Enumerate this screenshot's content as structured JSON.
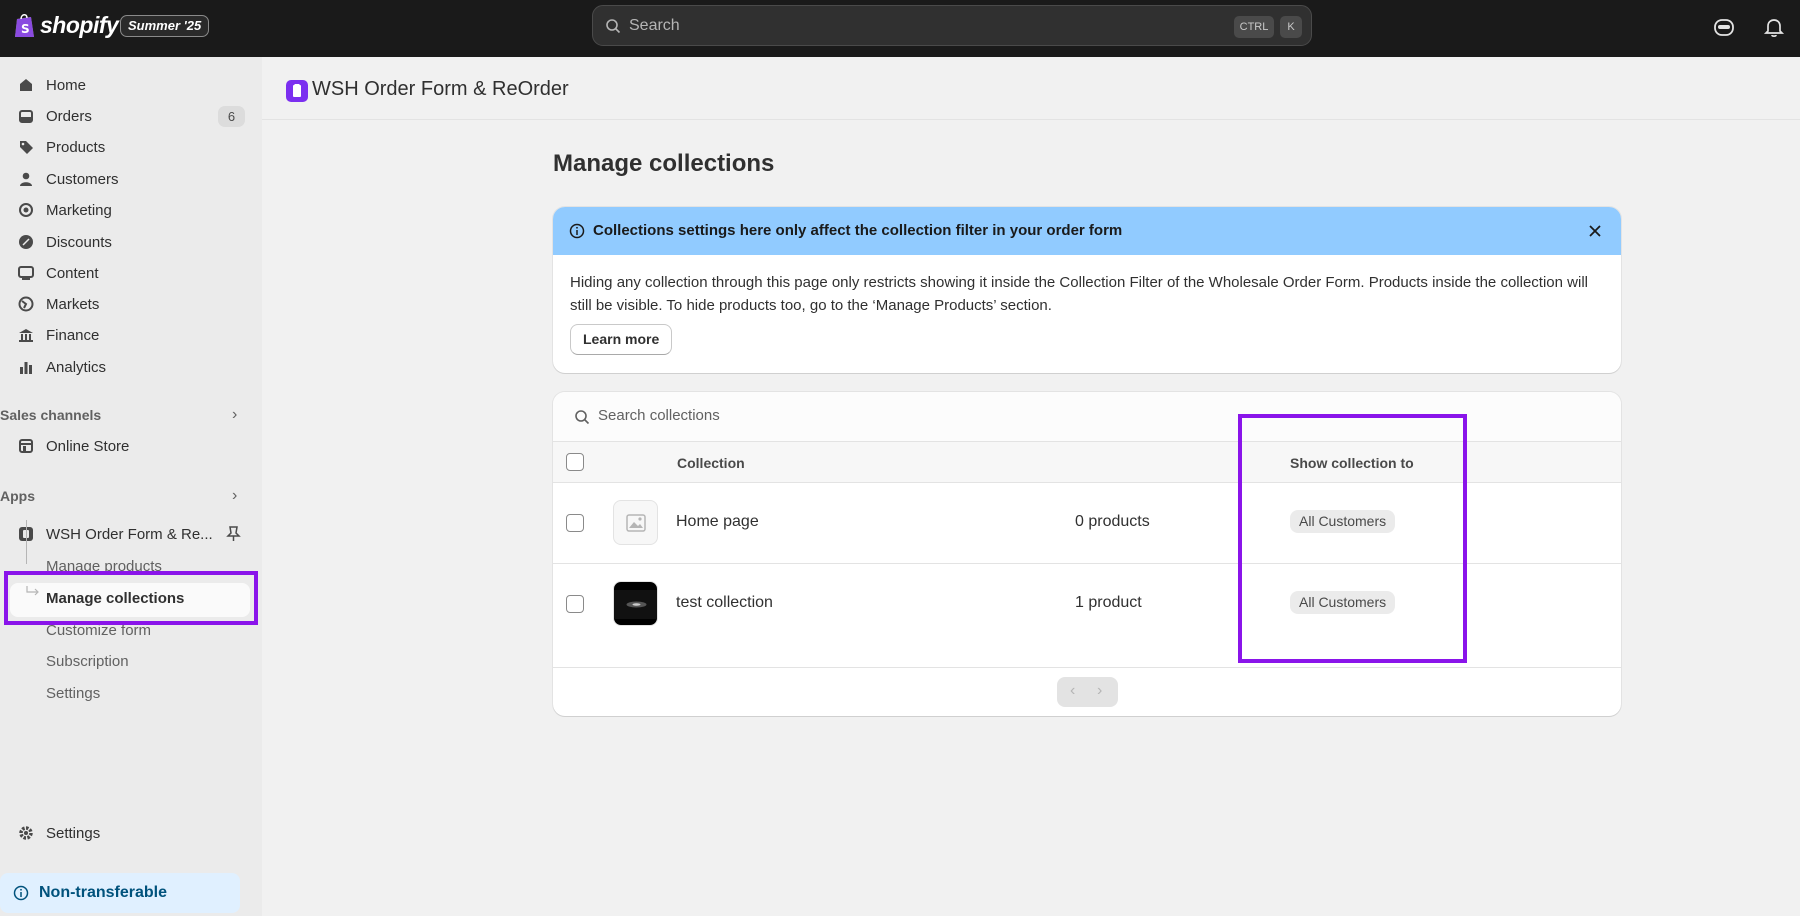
{
  "topbar": {
    "brand": "shopify",
    "edition_badge": "Summer '25",
    "search_placeholder": "Search",
    "shortcut_ctrl": "CTRL",
    "shortcut_key": "K"
  },
  "sidebar": {
    "items": [
      {
        "label": "Home",
        "icon": "home-icon"
      },
      {
        "label": "Orders",
        "icon": "orders-icon",
        "badge": "6"
      },
      {
        "label": "Products",
        "icon": "tag-icon"
      },
      {
        "label": "Customers",
        "icon": "person-icon"
      },
      {
        "label": "Marketing",
        "icon": "target-icon"
      },
      {
        "label": "Discounts",
        "icon": "discount-icon"
      },
      {
        "label": "Content",
        "icon": "image-icon"
      },
      {
        "label": "Markets",
        "icon": "globe-icon"
      },
      {
        "label": "Finance",
        "icon": "bank-icon"
      },
      {
        "label": "Analytics",
        "icon": "chart-icon"
      }
    ],
    "sales_channels_heading": "Sales channels",
    "online_store": "Online Store",
    "apps_heading": "Apps",
    "app_name": "WSH Order Form & Re...",
    "app_subitems": [
      "Manage products",
      "Manage collections",
      "Customize form",
      "Subscription",
      "Settings"
    ],
    "settings": "Settings",
    "non_transferable": "Non-transferable"
  },
  "app_header": {
    "title": "WSH Order Form & ReOrder"
  },
  "page": {
    "title": "Manage collections",
    "banner": {
      "title": "Collections settings here only affect the collection filter in your order form",
      "body": "Hiding any collection through this page only restricts showing it inside the Collection Filter of the Wholesale Order Form. Products inside the collection will still be visible. To hide products too, go to the ‘Manage Products’ section.",
      "learn_more": "Learn more"
    },
    "table": {
      "search_placeholder": "Search collections",
      "headers": {
        "collection": "Collection",
        "show_to": "Show collection to"
      },
      "rows": [
        {
          "name": "Home page",
          "products": "0 products",
          "audience": "All Customers"
        },
        {
          "name": "test collection",
          "products": "1 product",
          "audience": "All Customers"
        }
      ]
    }
  },
  "colors": {
    "topbar_bg": "#1a1a1a",
    "banner_bg": "#91cbff",
    "highlight": "#8a14ea",
    "app_accent": "#7b2ff0"
  }
}
